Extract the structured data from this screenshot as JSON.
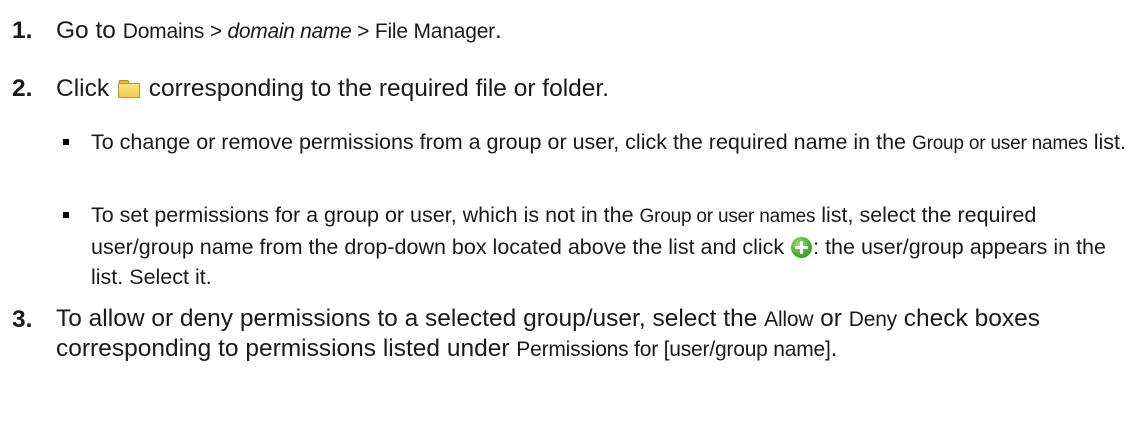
{
  "steps": [
    {
      "number": "1.",
      "text_before": "Go to ",
      "ui_path": "Domains > ",
      "domain_name": "domain name",
      "ui_path_end": " > File Manager",
      "text_after": "."
    },
    {
      "number": "2.",
      "text_before": "Click ",
      "icon": "folder-icon",
      "text_after": " corresponding to the required file or folder.",
      "bullets": [
        {
          "text_before": "To change or remove permissions from a group or user, click the required name in the ",
          "ui_term": "Group or user names",
          "text_after": " list."
        },
        {
          "text_before": "To set permissions for a group or user, which is not in the ",
          "ui_term": "Group or user names",
          "text_mid": " list, select the required user/group name from the drop-down box located above the list and click ",
          "icon": "add-plus-icon",
          "text_after": ": the user/group appears in the list. Select it."
        }
      ]
    },
    {
      "number": "3.",
      "text_before": "To allow or deny permissions to a selected group/user, select the ",
      "ui_allow": "Allow",
      "text_mid1": " or ",
      "ui_deny": "Deny",
      "text_mid2": " check boxes corresponding to permissions listed under ",
      "ui_permissions": "Permissions for [user/group name]",
      "text_after": "."
    }
  ],
  "colors": {
    "text": "#1a1a1a",
    "folder": "#f2c94a",
    "plus": "#4aae2b"
  }
}
